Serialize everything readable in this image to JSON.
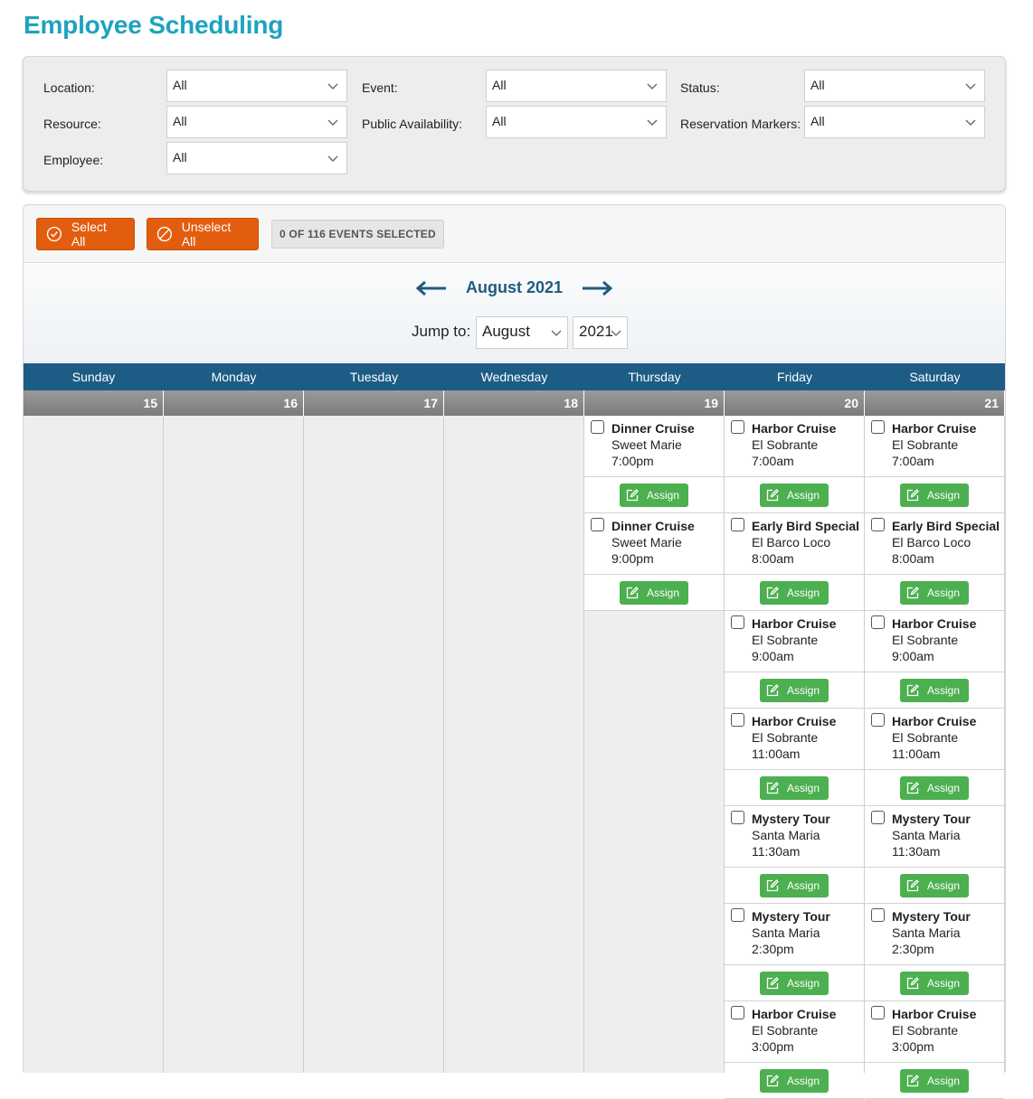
{
  "page": {
    "title": "Employee Scheduling"
  },
  "filters": {
    "location": {
      "label": "Location:",
      "value": "All"
    },
    "event": {
      "label": "Event:",
      "value": "All"
    },
    "status": {
      "label": "Status:",
      "value": "All"
    },
    "resource": {
      "label": "Resource:",
      "value": "All"
    },
    "public_availability": {
      "label": "Public Availability:",
      "value": "All"
    },
    "reservation_markers": {
      "label": "Reservation Markers:",
      "value": "All"
    },
    "employee": {
      "label": "Employee:",
      "value": "All"
    }
  },
  "toolbar": {
    "select_all_label": "Select All",
    "unselect_all_label": "Unselect All",
    "selection_count": "0 OF 116 EVENTS SELECTED"
  },
  "calendar": {
    "month_title": "August 2021",
    "jump_label": "Jump to:",
    "jump_month": "August",
    "jump_year": "2021",
    "weekdays": [
      "Sunday",
      "Monday",
      "Tuesday",
      "Wednesday",
      "Thursday",
      "Friday",
      "Saturday"
    ],
    "dates": [
      "15",
      "16",
      "17",
      "18",
      "19",
      "20",
      "21"
    ],
    "assign_label": "Assign",
    "accent_color": "#1d5c85",
    "days": [
      {
        "events": []
      },
      {
        "events": []
      },
      {
        "events": []
      },
      {
        "events": []
      },
      {
        "events": [
          {
            "name": "Dinner Cruise",
            "vessel": "Sweet Marie",
            "time": "7:00pm"
          },
          {
            "name": "Dinner Cruise",
            "vessel": "Sweet Marie",
            "time": "9:00pm"
          }
        ]
      },
      {
        "events": [
          {
            "name": "Harbor Cruise",
            "vessel": "El Sobrante",
            "time": "7:00am"
          },
          {
            "name": "Early Bird Special",
            "vessel": "El Barco Loco",
            "time": "8:00am"
          },
          {
            "name": "Harbor Cruise",
            "vessel": "El Sobrante",
            "time": "9:00am"
          },
          {
            "name": "Harbor Cruise",
            "vessel": "El Sobrante",
            "time": "11:00am"
          },
          {
            "name": "Mystery Tour",
            "vessel": "Santa Maria",
            "time": "11:30am"
          },
          {
            "name": "Mystery Tour",
            "vessel": "Santa Maria",
            "time": "2:30pm"
          },
          {
            "name": "Harbor Cruise",
            "vessel": "El Sobrante",
            "time": "3:00pm"
          }
        ]
      },
      {
        "events": [
          {
            "name": "Harbor Cruise",
            "vessel": "El Sobrante",
            "time": "7:00am"
          },
          {
            "name": "Early Bird Special",
            "vessel": "El Barco Loco",
            "time": "8:00am"
          },
          {
            "name": "Harbor Cruise",
            "vessel": "El Sobrante",
            "time": "9:00am"
          },
          {
            "name": "Harbor Cruise",
            "vessel": "El Sobrante",
            "time": "11:00am"
          },
          {
            "name": "Mystery Tour",
            "vessel": "Santa Maria",
            "time": "11:30am"
          },
          {
            "name": "Mystery Tour",
            "vessel": "Santa Maria",
            "time": "2:30pm"
          },
          {
            "name": "Harbor Cruise",
            "vessel": "El Sobrante",
            "time": "3:00pm"
          }
        ]
      }
    ]
  }
}
